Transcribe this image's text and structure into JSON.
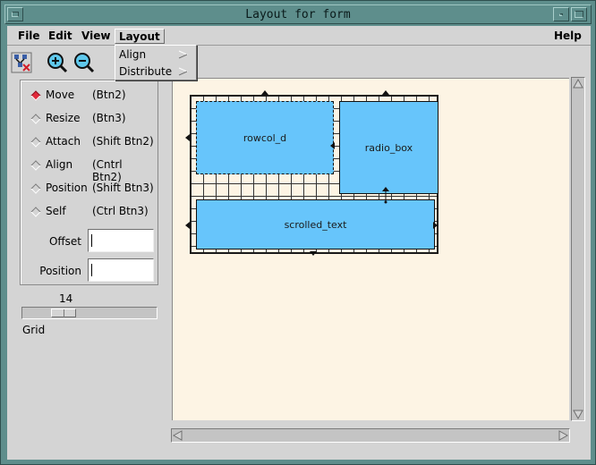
{
  "window": {
    "title": "Layout for form"
  },
  "menubar": {
    "file": "File",
    "edit": "Edit",
    "view": "View",
    "layout": "Layout",
    "help": "Help"
  },
  "layout_menu": {
    "items": [
      {
        "label": "Align",
        "has_submenu": true
      },
      {
        "label": "Distribute",
        "has_submenu": true
      }
    ]
  },
  "toolbar": {
    "icons": [
      "widget-tree-icon",
      "zoom-in-icon",
      "zoom-out-icon"
    ]
  },
  "modes": [
    {
      "label": "Move",
      "button": "(Btn2)",
      "selected": true
    },
    {
      "label": "Resize",
      "button": "(Btn3)",
      "selected": false
    },
    {
      "label": "Attach",
      "button": "(Shift Btn2)",
      "selected": false
    },
    {
      "label": "Align",
      "button": "(Cntrl Btn2)",
      "selected": false
    },
    {
      "label": "Position",
      "button": "(Shift Btn3)",
      "selected": false
    },
    {
      "label": "Self",
      "button": "(Ctrl Btn3)",
      "selected": false
    }
  ],
  "fields": {
    "offset_label": "Offset",
    "offset_value": "",
    "position_label": "Position",
    "position_value": ""
  },
  "grid": {
    "value": "14",
    "label": "Grid"
  },
  "canvas": {
    "widgets": [
      {
        "name": "rowcol_d"
      },
      {
        "name": "radio_box"
      },
      {
        "name": "scrolled_text"
      }
    ]
  },
  "colors": {
    "frame": "#5e8e8c",
    "client": "#d4d4d4",
    "canvas": "#fdf4e4",
    "widget": "#67c5fb",
    "selected_radio": "#e0283a"
  }
}
